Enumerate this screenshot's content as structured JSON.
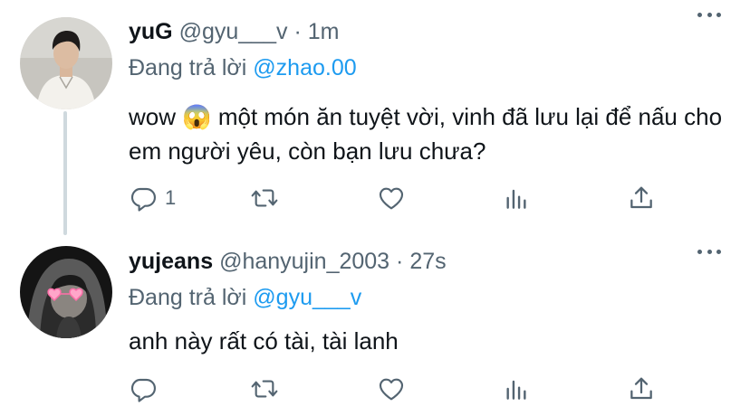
{
  "replies": [
    {
      "name": "yuG",
      "handle": "@gyu___v",
      "separator": "·",
      "time": "1m",
      "replying_prefix": "Đang trả lời",
      "replying_to": "@zhao.00",
      "text": "wow 😱  một món ăn tuyệt vời, vinh đã lưu lại để nấu cho em người yêu, còn bạn lưu chưa?",
      "reply_count": "1",
      "avatar": "avatar-man-white-shirt"
    },
    {
      "name": "yujeans",
      "handle": "@hanyujin_2003",
      "separator": "·",
      "time": "27s",
      "replying_prefix": "Đang trả lời",
      "replying_to": "@gyu___v",
      "text": "anh này rất có tài, tài lanh",
      "reply_count": "",
      "avatar": "avatar-hoodie-heart-glasses"
    }
  ],
  "colors": {
    "link": "#1d9bf0",
    "secondary_text": "#536471",
    "thread_line": "#cfd9de"
  }
}
